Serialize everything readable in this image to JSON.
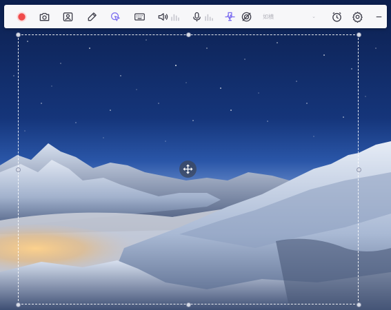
{
  "toolbar": {
    "mode_select": {
      "value": "如横"
    },
    "icons": [
      "record-icon",
      "camera-icon",
      "webcam-user-icon",
      "pen-icon",
      "cursor-click-icon",
      "keyboard-icon",
      "speaker-icon",
      "system-audio-level-icon",
      "microphone-icon",
      "mic-level-icon",
      "noise-reduction-icon",
      "no-target-icon",
      "chevron-down-icon",
      "timer-icon",
      "gear-icon",
      "minimize-icon"
    ],
    "colors": {
      "record": "#f04a4a",
      "accent": "#7b6cf0",
      "icon": "#3c3c48"
    }
  },
  "capture_region": {
    "icons": [
      "move-handle-icon"
    ]
  }
}
